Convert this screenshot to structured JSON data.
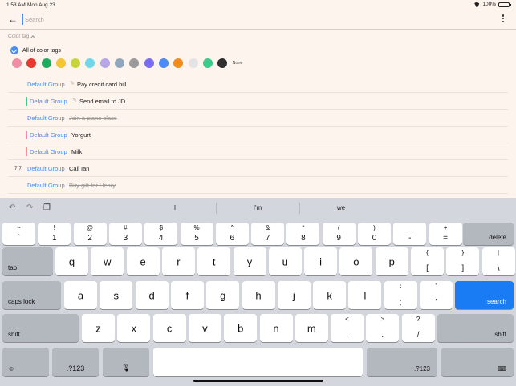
{
  "status": {
    "time": "1:53 AM",
    "date": "Mon Aug 23",
    "battery": "100%"
  },
  "search": {
    "placeholder": "Search",
    "value": ""
  },
  "color_tag": {
    "header": "Color tag",
    "all_label": "All of color tags",
    "none_label": "None",
    "swatches": [
      "#f18ca2",
      "#e8392f",
      "#1faa5e",
      "#f4c53a",
      "#c5d53a",
      "#6fd7e8",
      "#b7a6e8",
      "#8fa6bd",
      "#9a9a9a",
      "#7a6cf0",
      "#4a8cf2",
      "#f28a1d",
      "#e3e3e3",
      "#3fc98a",
      "#2f2f2f"
    ]
  },
  "tasks": [
    {
      "group": "Default Group",
      "title": "Pay credit card bill",
      "pinned": true,
      "done": false,
      "bar": "",
      "num": ""
    },
    {
      "group": "Default Group",
      "title": "Send email to JD",
      "pinned": true,
      "done": false,
      "bar": "#3fc98a",
      "num": ""
    },
    {
      "group": "Default Group",
      "title": "Join a piano class",
      "pinned": false,
      "done": true,
      "bar": "",
      "num": ""
    },
    {
      "group": "Default Group",
      "title": "Yorgurt",
      "pinned": false,
      "done": false,
      "bar": "#f18ca2",
      "num": ""
    },
    {
      "group": "Default Group",
      "title": "Milk",
      "pinned": false,
      "done": false,
      "bar": "#f18ca2",
      "num": ""
    },
    {
      "group": "Default Group",
      "title": "Call Ian",
      "pinned": false,
      "done": false,
      "bar": "",
      "num": "7.7"
    },
    {
      "group": "Default Group",
      "title": "Buy gift for Henry",
      "pinned": false,
      "done": true,
      "bar": "",
      "num": ""
    }
  ],
  "keyboard": {
    "suggestions": [
      "I",
      "I'm",
      "we"
    ],
    "row1": [
      [
        "~",
        "`"
      ],
      [
        "!",
        "1"
      ],
      [
        "@",
        "2"
      ],
      [
        "#",
        "3"
      ],
      [
        "$",
        "4"
      ],
      [
        "%",
        "5"
      ],
      [
        "^",
        "6"
      ],
      [
        "&",
        "7"
      ],
      [
        "*",
        "8"
      ],
      [
        "(",
        "9"
      ],
      [
        ")",
        "0"
      ],
      [
        "_",
        "-"
      ],
      [
        "+",
        "="
      ]
    ],
    "row2": [
      "q",
      "w",
      "e",
      "r",
      "t",
      "y",
      "u",
      "i",
      "o",
      "p"
    ],
    "row2_extra": [
      [
        "{",
        "["
      ],
      [
        "}",
        "]"
      ],
      [
        "|",
        "\\"
      ]
    ],
    "row3": [
      "a",
      "s",
      "d",
      "f",
      "g",
      "h",
      "j",
      "k",
      "l"
    ],
    "row3_extra": [
      [
        ":",
        ";"
      ],
      [
        "”",
        "’"
      ]
    ],
    "row4": [
      "z",
      "x",
      "c",
      "v",
      "b",
      "n",
      "m"
    ],
    "row4_extra": [
      [
        "<",
        ","
      ],
      [
        ">",
        "."
      ],
      [
        "?",
        "/"
      ]
    ],
    "labels": {
      "delete": "delete",
      "tab": "tab",
      "caps_lock": "caps lock",
      "search": "search",
      "shift": "shift",
      "numbers": ".?123"
    }
  }
}
